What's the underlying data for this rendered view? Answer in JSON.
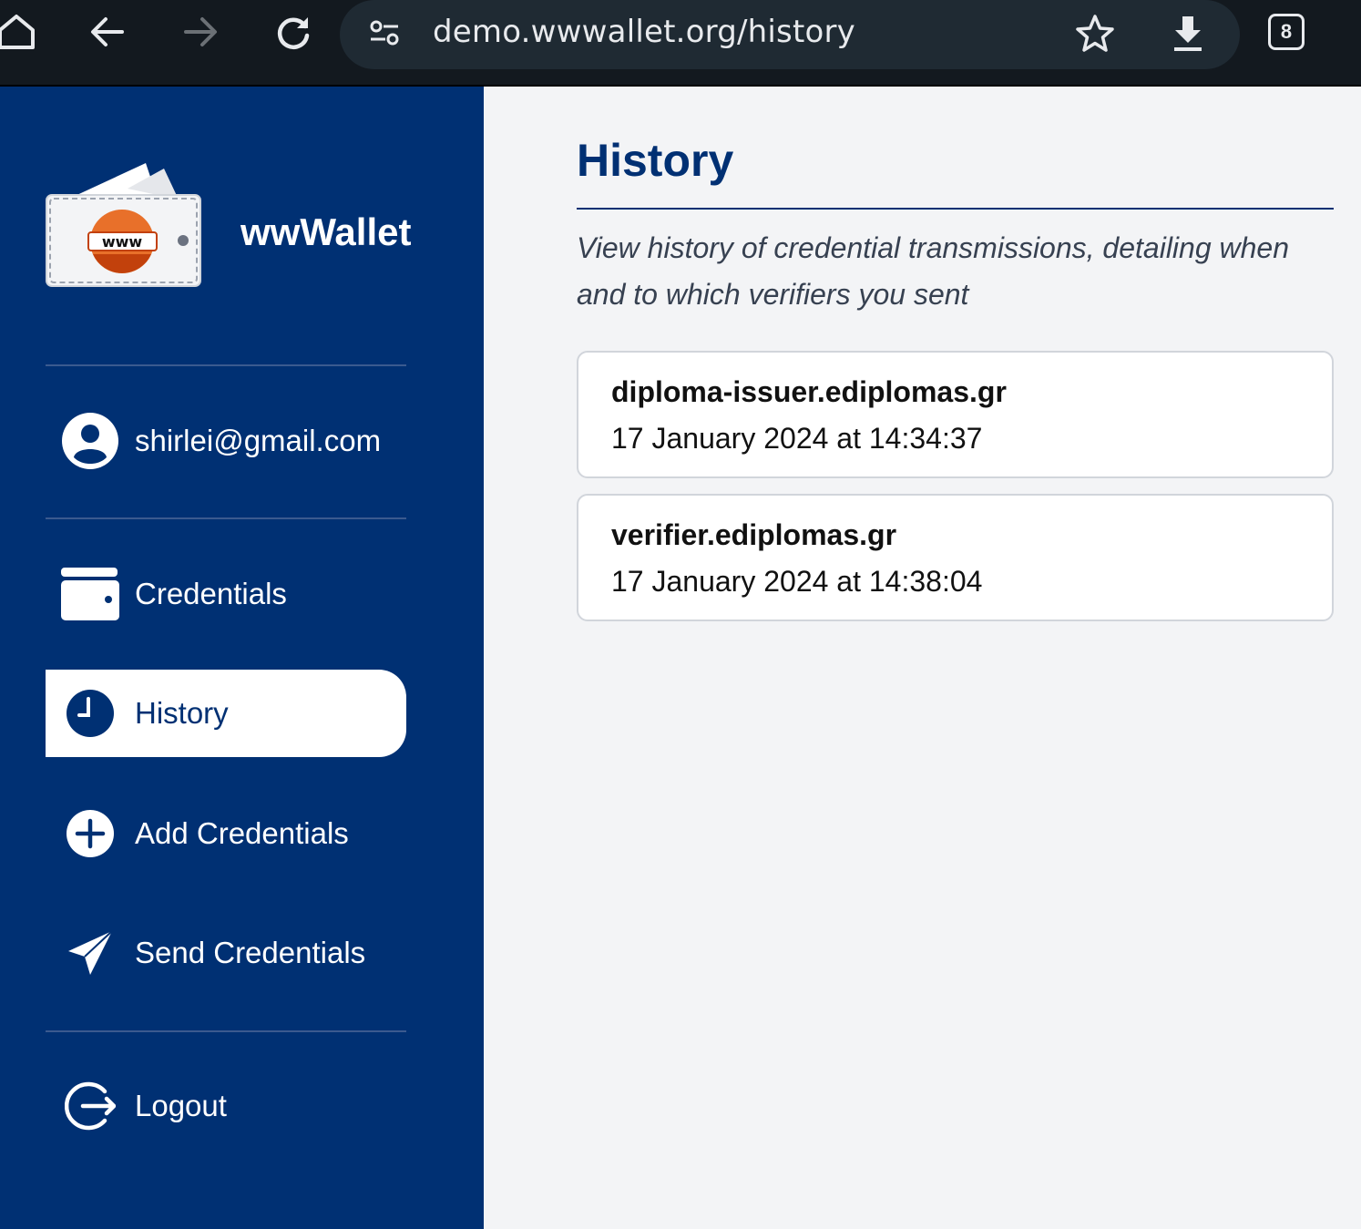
{
  "browser": {
    "url": "demo.wwwallet.org/history",
    "tab_count": "8"
  },
  "sidebar": {
    "brand": "wwWallet",
    "logo_text": "www",
    "user_email": "shirlei@gmail.com",
    "nav": [
      {
        "label": "Credentials",
        "icon": "wallet-icon"
      },
      {
        "label": "History",
        "icon": "clock-icon",
        "active": true
      },
      {
        "label": "Add Credentials",
        "icon": "plus-circle-icon"
      },
      {
        "label": "Send Credentials",
        "icon": "paper-plane-icon"
      }
    ],
    "logout_label": "Logout"
  },
  "main": {
    "title": "History",
    "description": "View history of credential transmissions, detailing when and to which verifiers you sent",
    "entries": [
      {
        "verifier": "diploma-issuer.ediplomas.gr",
        "date": "17 January 2024 at 14:34:37"
      },
      {
        "verifier": "verifier.ediplomas.gr",
        "date": "17 January 2024 at 14:38:04"
      }
    ]
  },
  "colors": {
    "primary": "#003073",
    "background": "#f3f4f6",
    "browser_chrome": "#13191f"
  }
}
